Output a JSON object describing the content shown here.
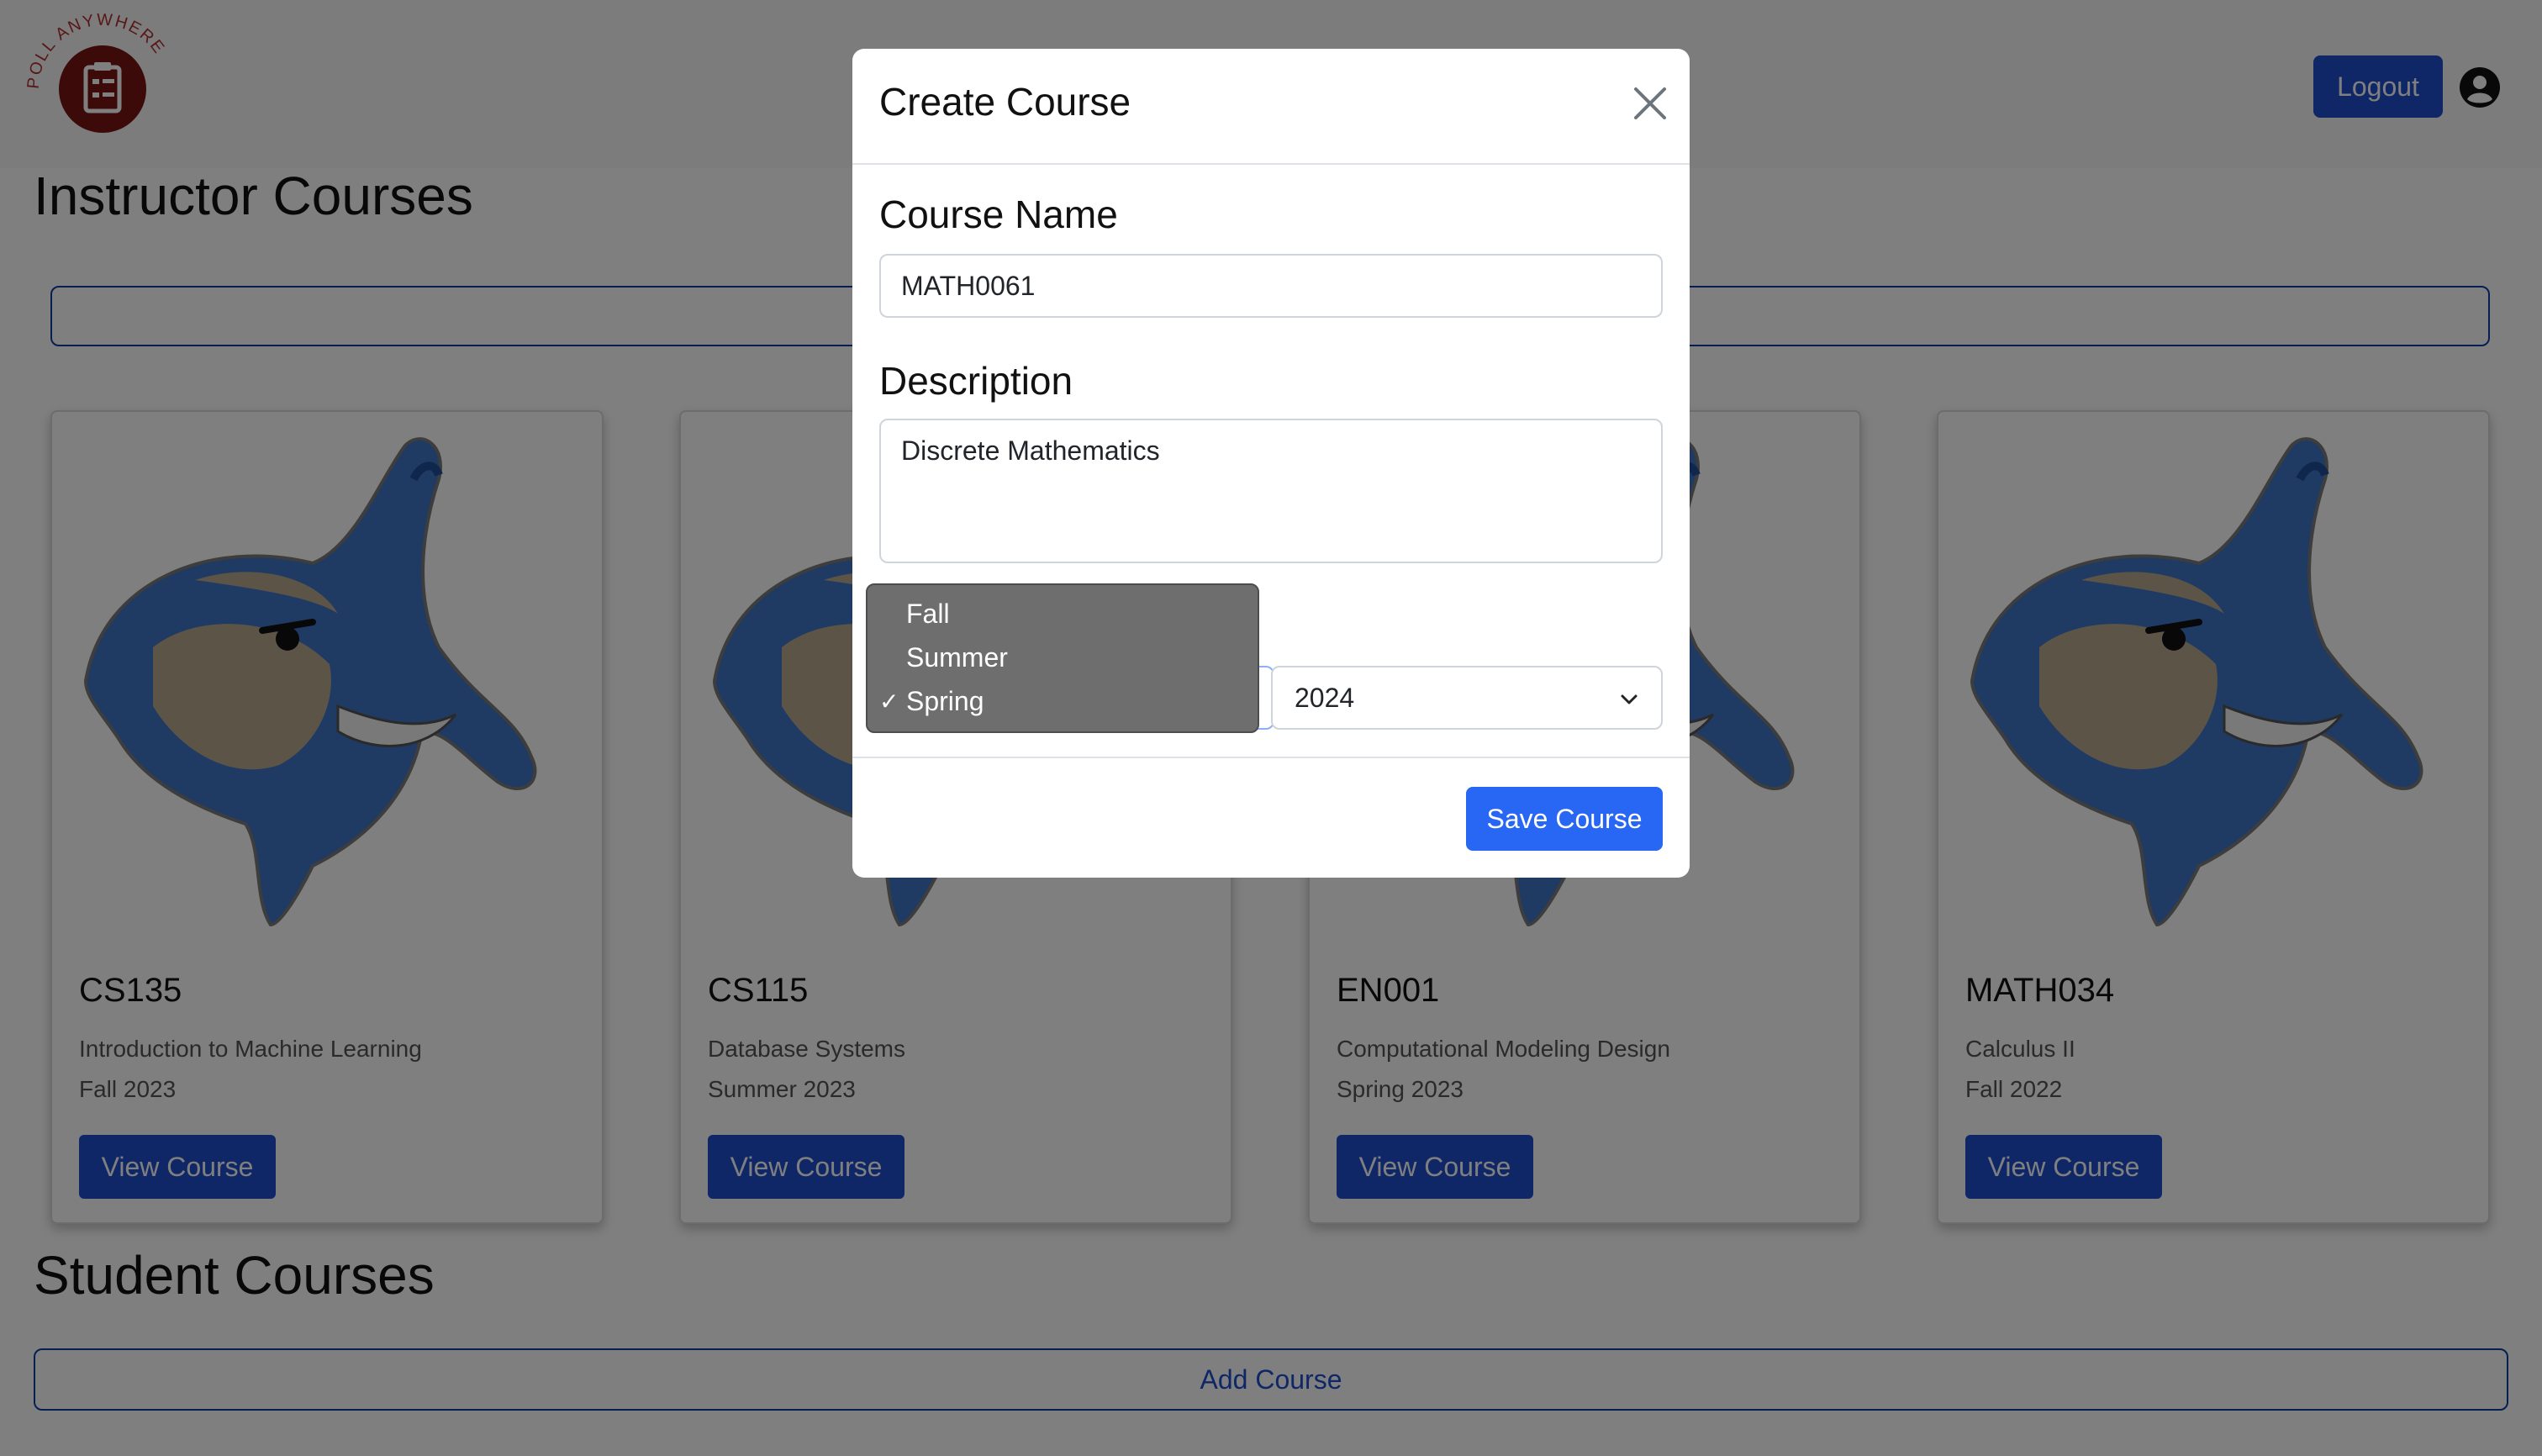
{
  "header": {
    "logo_text": "POLL ANYWHERE",
    "logout_label": "Logout",
    "user_icon": "user-circle-icon"
  },
  "sections": {
    "instructor_title": "Instructor Courses",
    "student_title": "Student Courses"
  },
  "cards": [
    {
      "code": "CS135",
      "description": "Introduction to Machine Learning",
      "term": "Fall 2023",
      "button_label": "View Course"
    },
    {
      "code": "CS115",
      "description": "Database Systems",
      "term": "Summer 2023",
      "button_label": "View Course"
    },
    {
      "code": "EN001",
      "description": "Computational Modeling Design",
      "term": "Spring 2023",
      "button_label": "View Course"
    },
    {
      "code": "MATH034",
      "description": "Calculus II",
      "term": "Fall 2022",
      "button_label": "View Course"
    }
  ],
  "add_course_label": "Add Course",
  "modal": {
    "title": "Create Course",
    "close_icon": "close-icon",
    "course_name_label": "Course Name",
    "course_name_value": "MATH0061",
    "description_label": "Description",
    "description_value": "Discrete Mathematics",
    "term_options": [
      "Fall",
      "Summer",
      "Spring"
    ],
    "term_selected": "Spring",
    "check_mark": "✓",
    "year_value": "2024",
    "save_label": "Save Course"
  },
  "colors": {
    "primary": "#1f4fcf",
    "save_button": "#2767f3",
    "mascot_blue": "#3f74c6",
    "mascot_tan": "#b8a98e",
    "logo_red": "#7a1414"
  }
}
